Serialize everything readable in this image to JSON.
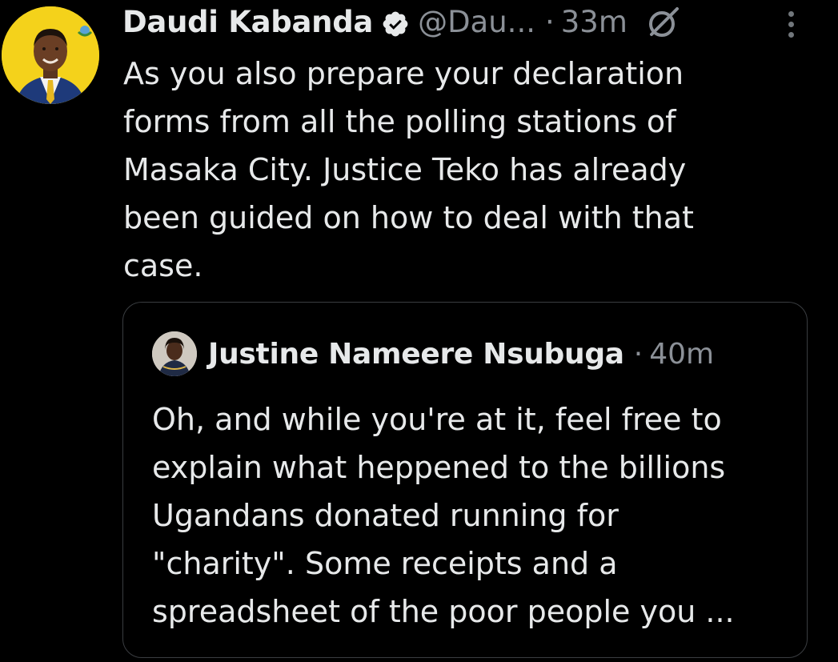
{
  "tweet": {
    "author": {
      "display_name": "Daudi Kabanda",
      "handle": "@Dau...",
      "verified_icon": "verified-badge-icon"
    },
    "separator": "·",
    "time": "33m",
    "grok_icon": "grok-icon",
    "more_icon": "more-dots-icon",
    "text": "As you also prepare your declaration\nforms from all the polling stations of\nMasaka City. Justice Teko has already\nbeen guided on how to deal with that\ncase."
  },
  "quote": {
    "author": {
      "display_name": "Justine Nameere Nsubuga"
    },
    "separator": "·",
    "time": "40m",
    "text": "Oh, and while you're at it, feel free to\nexplain what heppened to the billions\nUgandans donated running for\n\"charity\". Some receipts and a\nspreadsheet of the poor people you ..."
  },
  "colors": {
    "background": "#000000",
    "text_primary": "#e7e9ea",
    "text_secondary": "#8b9097",
    "verified_blue": "#1d9bf0",
    "quote_border": "#3a3d41",
    "avatar_yellow": "#f4d21b"
  }
}
